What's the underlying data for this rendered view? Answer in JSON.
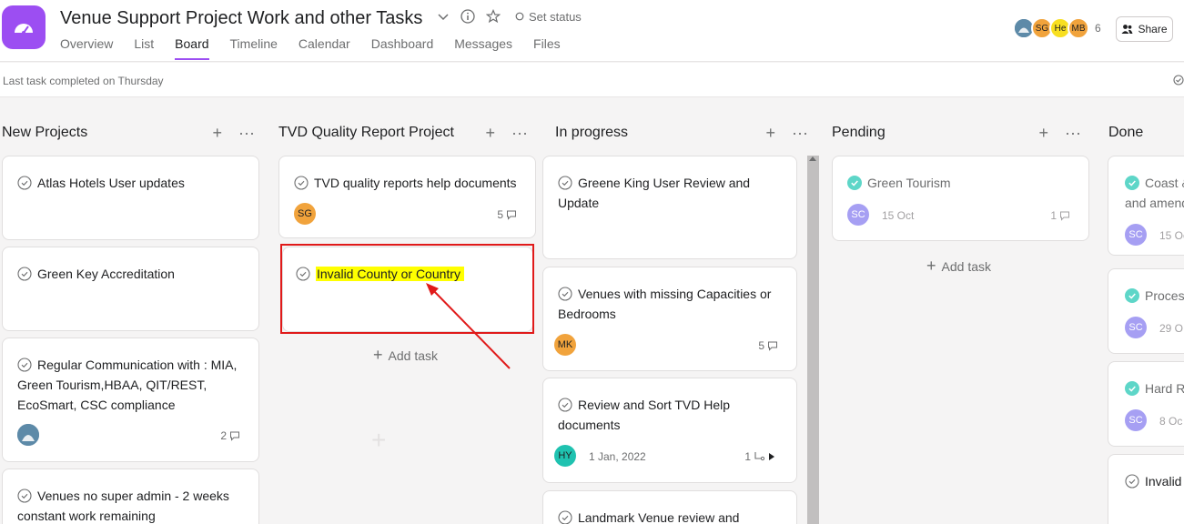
{
  "header": {
    "title": "Venue Support Project Work and other Tasks",
    "set_status": "Set status",
    "tabs": [
      "Overview",
      "List",
      "Board",
      "Timeline",
      "Calendar",
      "Dashboard",
      "Messages",
      "Files"
    ],
    "active_tab": "Board",
    "members": [
      {
        "initials": "",
        "color": "#4a7a99"
      },
      {
        "initials": "SG",
        "color": "#f1a33c"
      },
      {
        "initials": "He",
        "color": "#f8df20"
      },
      {
        "initials": "MB",
        "color": "#f1a33c"
      }
    ],
    "member_count": "6",
    "share_label": "Share"
  },
  "subbar": {
    "last_completed": "Last task completed on Thursday"
  },
  "colors": {
    "accent": "#9c4ef2",
    "highlight": "#ffff00",
    "annotation": "#e01a1a",
    "complete_check": "#5ed6c8"
  },
  "columns": [
    {
      "title": "New Projects",
      "cards": [
        {
          "title": "Atlas Hotels User updates"
        },
        {
          "title": "Green Key Accreditation"
        },
        {
          "title": "Regular Communication with : MIA, Green Tourism,HBAA, QIT/REST, EcoSmart, CSC compliance",
          "comments": "2"
        },
        {
          "title": "Venues no super admin - 2 weeks constant work remaining"
        }
      ]
    },
    {
      "title": "TVD Quality Report Project",
      "cards": [
        {
          "title": "TVD quality reports help documents",
          "assignee": "SG",
          "comments": "5"
        },
        {
          "title": "Invalid County or Country"
        }
      ],
      "add_task": "Add task"
    },
    {
      "title": "In progress",
      "cards": [
        {
          "title": "Greene King User Review and Update"
        },
        {
          "title": "Venues with missing Capacities or Bedrooms",
          "assignee": "MK",
          "comments": "5"
        },
        {
          "title": "Review and Sort TVD Help documents",
          "assignee": "HY",
          "date": "1 Jan, 2022",
          "subtasks": "1"
        },
        {
          "title": "Landmark Venue review and"
        }
      ]
    },
    {
      "title": "Pending",
      "cards": [
        {
          "title": "Green Tourism",
          "assignee": "SC",
          "date": "15 Oct",
          "comments": "1"
        }
      ],
      "add_task": "Add task"
    },
    {
      "title": "Done",
      "cards": [
        {
          "title": "Coast &",
          "title2": "and amend",
          "assignee": "SC",
          "date": "15 Oc"
        },
        {
          "title": "Process",
          "assignee": "SC",
          "date": "29 O"
        },
        {
          "title": "Hard R",
          "assignee": "SC",
          "date": "8 Oc"
        },
        {
          "title": "Invalid"
        }
      ]
    }
  ]
}
